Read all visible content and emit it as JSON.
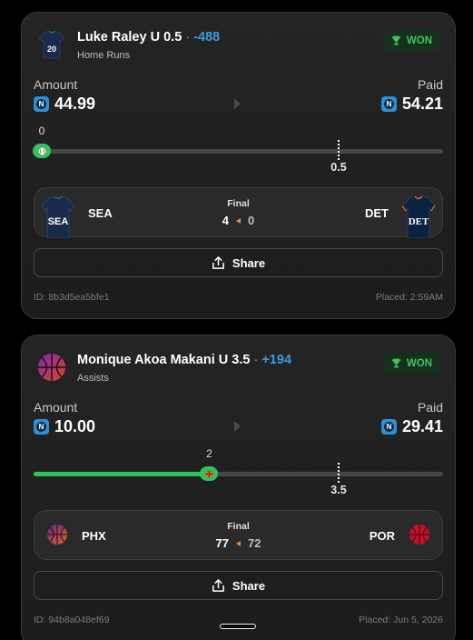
{
  "bets": [
    {
      "player": "Luke Raley",
      "pick": "U 0.5",
      "separator": "·",
      "odds": "-488",
      "stat": "Home Runs",
      "status": "WON",
      "amount_label": "Amount",
      "amount": "44.99",
      "paid_label": "Paid",
      "paid": "54.21",
      "current_value": "0",
      "current_fraction": 0.02,
      "line_value": "0.5",
      "line_fraction": 0.745,
      "game_status": "Final",
      "home_team": "SEA",
      "away_team": "DET",
      "home_score": "4",
      "away_score": "0",
      "share_label": "Share",
      "bet_id": "ID: 8b3d5ea5bfe1",
      "placed": "Placed: 2:59AM",
      "jersey_number": "20",
      "avatar_icon": "jersey-icon",
      "ball_icon": "baseball-icon"
    },
    {
      "player": "Monique Akoa Makani",
      "pick": "U 3.5",
      "separator": "·",
      "odds": "+194",
      "stat": "Assists",
      "status": "WON",
      "amount_label": "Amount",
      "amount": "10.00",
      "paid_label": "Paid",
      "paid": "29.41",
      "current_value": "2",
      "current_fraction": 0.429,
      "line_value": "3.5",
      "line_fraction": 0.745,
      "game_status": "Final",
      "home_team": "PHX",
      "away_team": "POR",
      "home_score": "77",
      "away_score": "72",
      "share_label": "Share",
      "bet_id": "ID: 94b8a048ef69",
      "placed": "Placed: Jun 5, 2026",
      "avatar_icon": "basketball-icon",
      "ball_icon": "basketball-icon"
    }
  ],
  "colors": {
    "won_green": "#33c15c",
    "odds_blue": "#3a9bdc",
    "coin_blue": "#2f8fd6",
    "seattle_navy": "#1a2a4a",
    "detroit_navy": "#0c2340",
    "phx_purple": "#5a2d82",
    "por_red": "#c8102e"
  }
}
